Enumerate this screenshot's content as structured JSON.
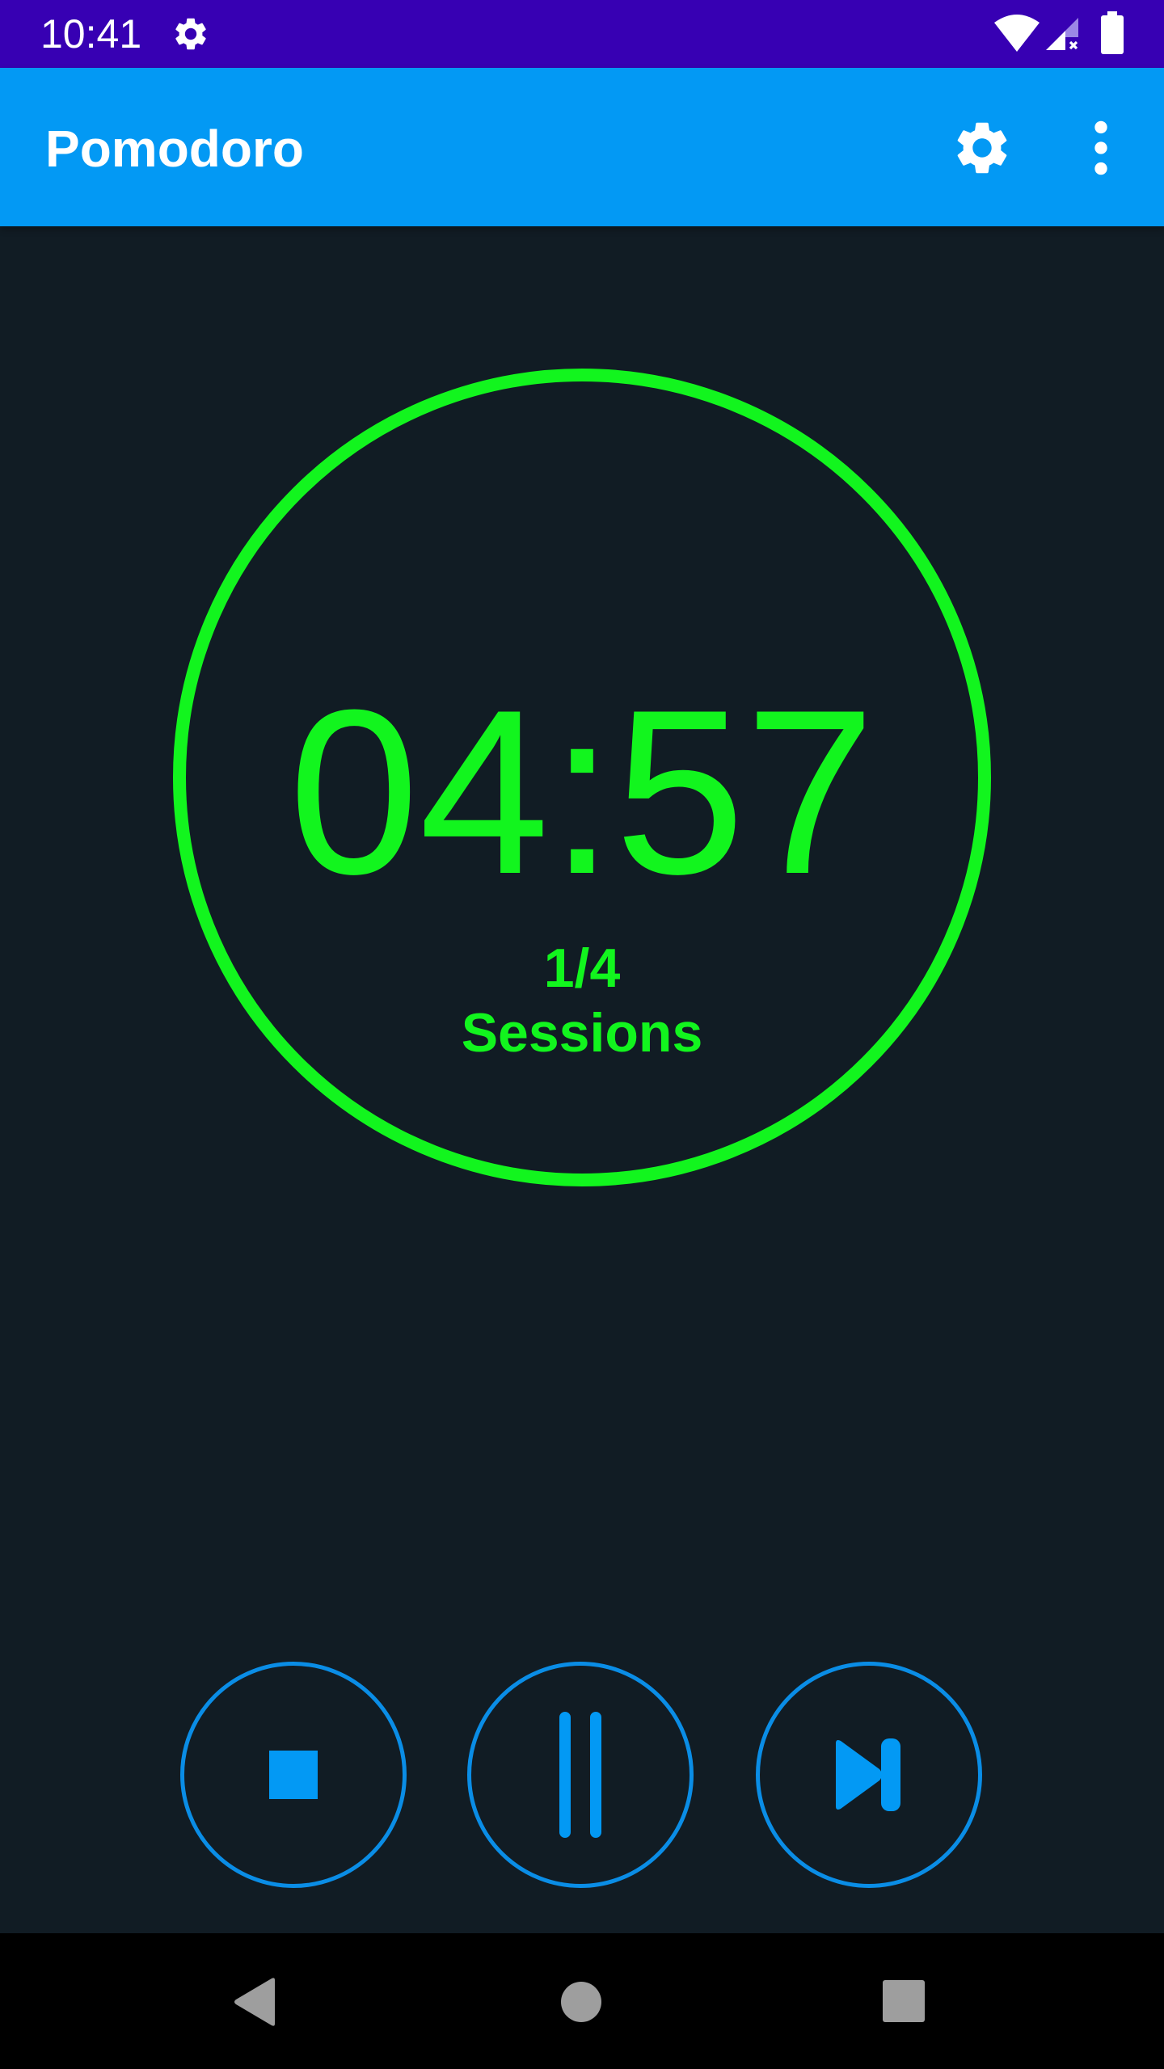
{
  "status_bar": {
    "time": "10:41",
    "icons": [
      "gear-icon",
      "wifi-icon",
      "signal-icon",
      "battery-icon"
    ],
    "background": "#3700b3"
  },
  "app_bar": {
    "title": "Pomodoro",
    "actions": [
      "settings-icon",
      "more-vert-icon"
    ],
    "background": "#0399f4"
  },
  "timer": {
    "time_remaining": "04:57",
    "session_count": "1/4",
    "session_label": "Sessions",
    "accent": "#12f51e"
  },
  "controls": {
    "buttons": [
      "stop-icon",
      "pause-icon",
      "skip-next-icon"
    ],
    "accent": "#0a8de6"
  },
  "navigation_bar": {
    "buttons": [
      "back-icon",
      "home-icon",
      "recents-icon"
    ]
  }
}
